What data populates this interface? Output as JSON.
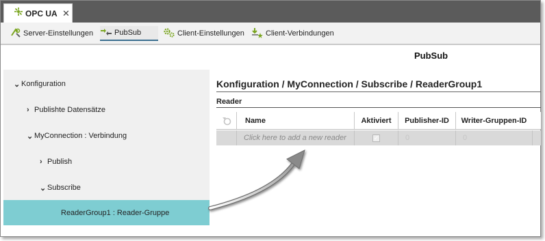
{
  "tab": {
    "label": "OPC UA",
    "close": "✕"
  },
  "toolbar": {
    "items": [
      {
        "label": "Server-Einstellungen",
        "icon": "server-settings-icon"
      },
      {
        "label": "PubSub",
        "icon": "pubsub-icon"
      },
      {
        "label": "Client-Einstellungen",
        "icon": "gears-icon"
      },
      {
        "label": "Client-Verbindungen",
        "icon": "client-connections-icon"
      }
    ],
    "active": "PubSub"
  },
  "page": {
    "title": "PubSub"
  },
  "tree": {
    "items": [
      {
        "label": "Konfiguration",
        "chevron": "⌄",
        "level": 0
      },
      {
        "label": "Publishte Datensätze",
        "chevron": "›",
        "level": 1
      },
      {
        "label": "MyConnection : Verbindung",
        "chevron": "⌄",
        "level": 1
      },
      {
        "label": "Publish",
        "chevron": "›",
        "level": 2
      },
      {
        "label": "Subscribe",
        "chevron": "⌄",
        "level": 2
      },
      {
        "label": "ReaderGroup1 : Reader-Gruppe",
        "chevron": "",
        "level": 3,
        "selected": true
      }
    ]
  },
  "main": {
    "breadcrumb": "Konfiguration / MyConnection / Subscribe / ReaderGroup1",
    "section": "Reader",
    "table": {
      "columns": [
        "Name",
        "Aktiviert",
        "Publisher-ID",
        "Writer-Gruppen-ID"
      ],
      "new_row": {
        "name_placeholder": "Click here to add a new reader",
        "aktiviert": true,
        "publisher_id": "0",
        "writer_group_id": "0"
      }
    }
  },
  "colors": {
    "accent": "#7ecdd2",
    "toolbar_bg": "#f2f2f2",
    "tabstrip": "#5b5b5b",
    "tree_bg": "#f0f0f0",
    "icon_green": "#7aa51f"
  }
}
